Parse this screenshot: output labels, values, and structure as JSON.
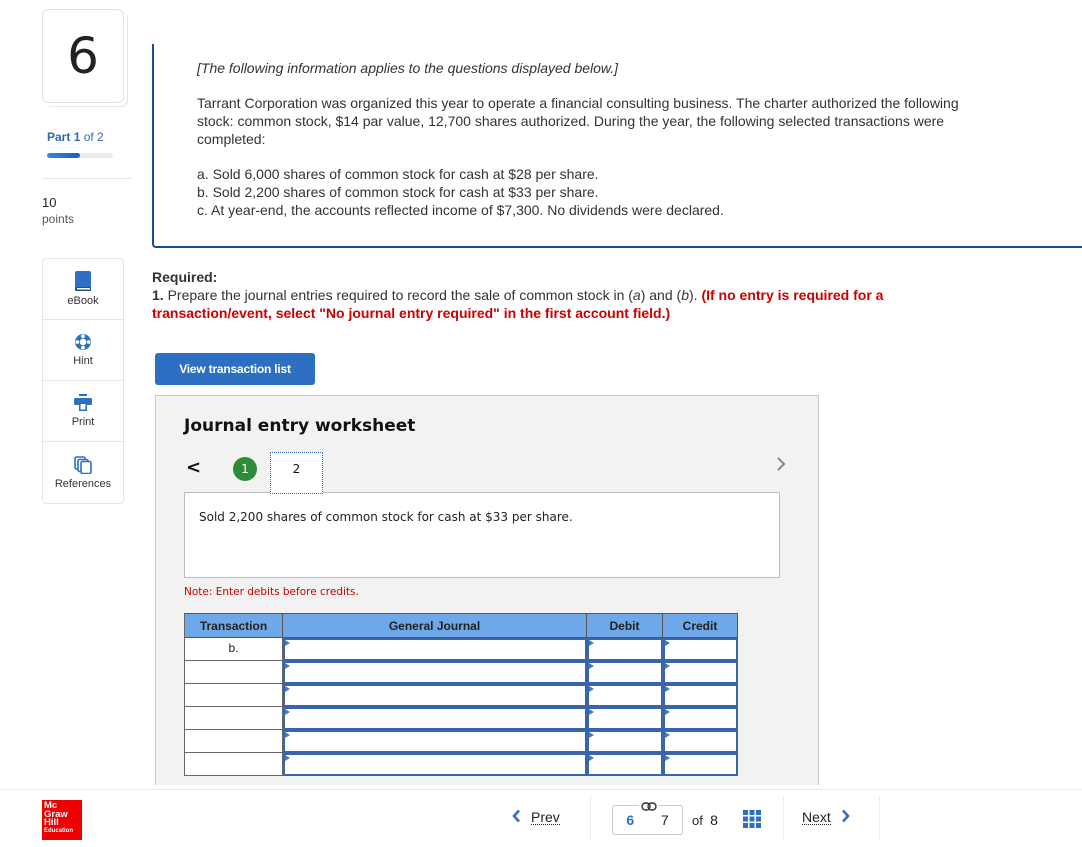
{
  "question": {
    "number": "6"
  },
  "part": {
    "prefix": "Part",
    "current": "1",
    "of_label": "of 2",
    "progress": 0.5
  },
  "points": {
    "value": "10",
    "label": "points"
  },
  "tools": [
    {
      "label": "eBook",
      "icon": "book-icon"
    },
    {
      "label": "Hint",
      "icon": "lifebuoy-icon"
    },
    {
      "label": "Print",
      "icon": "printer-icon"
    },
    {
      "label": "References",
      "icon": "copies-icon"
    }
  ],
  "intro": {
    "italic_note": "[The following information applies to the questions displayed below.]",
    "paragraph": "Tarrant Corporation was organized this year to operate a financial consulting business. The charter authorized the following stock: common stock, $14 par value, 12,700 shares authorized. During the year, the following selected transactions were completed:",
    "items": [
      "a. Sold 6,000 shares of common stock for cash at $28 per share.",
      "b. Sold 2,200 shares of common stock for cash at $33 per share.",
      "c. At year-end, the accounts reflected income of $7,300. No dividends were declared."
    ]
  },
  "required": {
    "title": "Required:",
    "num": "1.",
    "text": " Prepare the journal entries required to record the sale of common stock in (",
    "a": "a",
    "mid": ") and (",
    "b": "b",
    "end": "). ",
    "red_note": "(If no entry is required for a transaction/event, select \"No journal entry required\" in the first account field.)"
  },
  "view_transaction_button": "View transaction list",
  "worksheet": {
    "title": "Journal entry worksheet",
    "steps": [
      "1",
      "2"
    ],
    "active_step": "2",
    "description": "Sold 2,200 shares of common stock for cash at $33 per share.",
    "note": "Note: Enter debits before credits.",
    "columns": [
      "Transaction",
      "General Journal",
      "Debit",
      "Credit"
    ],
    "rows": [
      {
        "transaction": "b.",
        "account": "",
        "debit": "",
        "credit": ""
      },
      {
        "transaction": "",
        "account": "",
        "debit": "",
        "credit": ""
      },
      {
        "transaction": "",
        "account": "",
        "debit": "",
        "credit": ""
      },
      {
        "transaction": "",
        "account": "",
        "debit": "",
        "credit": ""
      },
      {
        "transaction": "",
        "account": "",
        "debit": "",
        "credit": ""
      },
      {
        "transaction": "",
        "account": "",
        "debit": "",
        "credit": ""
      }
    ]
  },
  "footer": {
    "logo_lines": [
      "Mc",
      "Graw",
      "Hill",
      "Education"
    ],
    "prev_label": "Prev",
    "next_label": "Next",
    "page_current": "6",
    "page_next": "7",
    "of_label": "of",
    "total": "8"
  },
  "colors": {
    "accent": "#2d6fc2",
    "header_blue": "#6fa8e8",
    "alert_red": "#cc0000",
    "step_done_green": "#2e8b3a",
    "logo_red": "#ee0000"
  }
}
